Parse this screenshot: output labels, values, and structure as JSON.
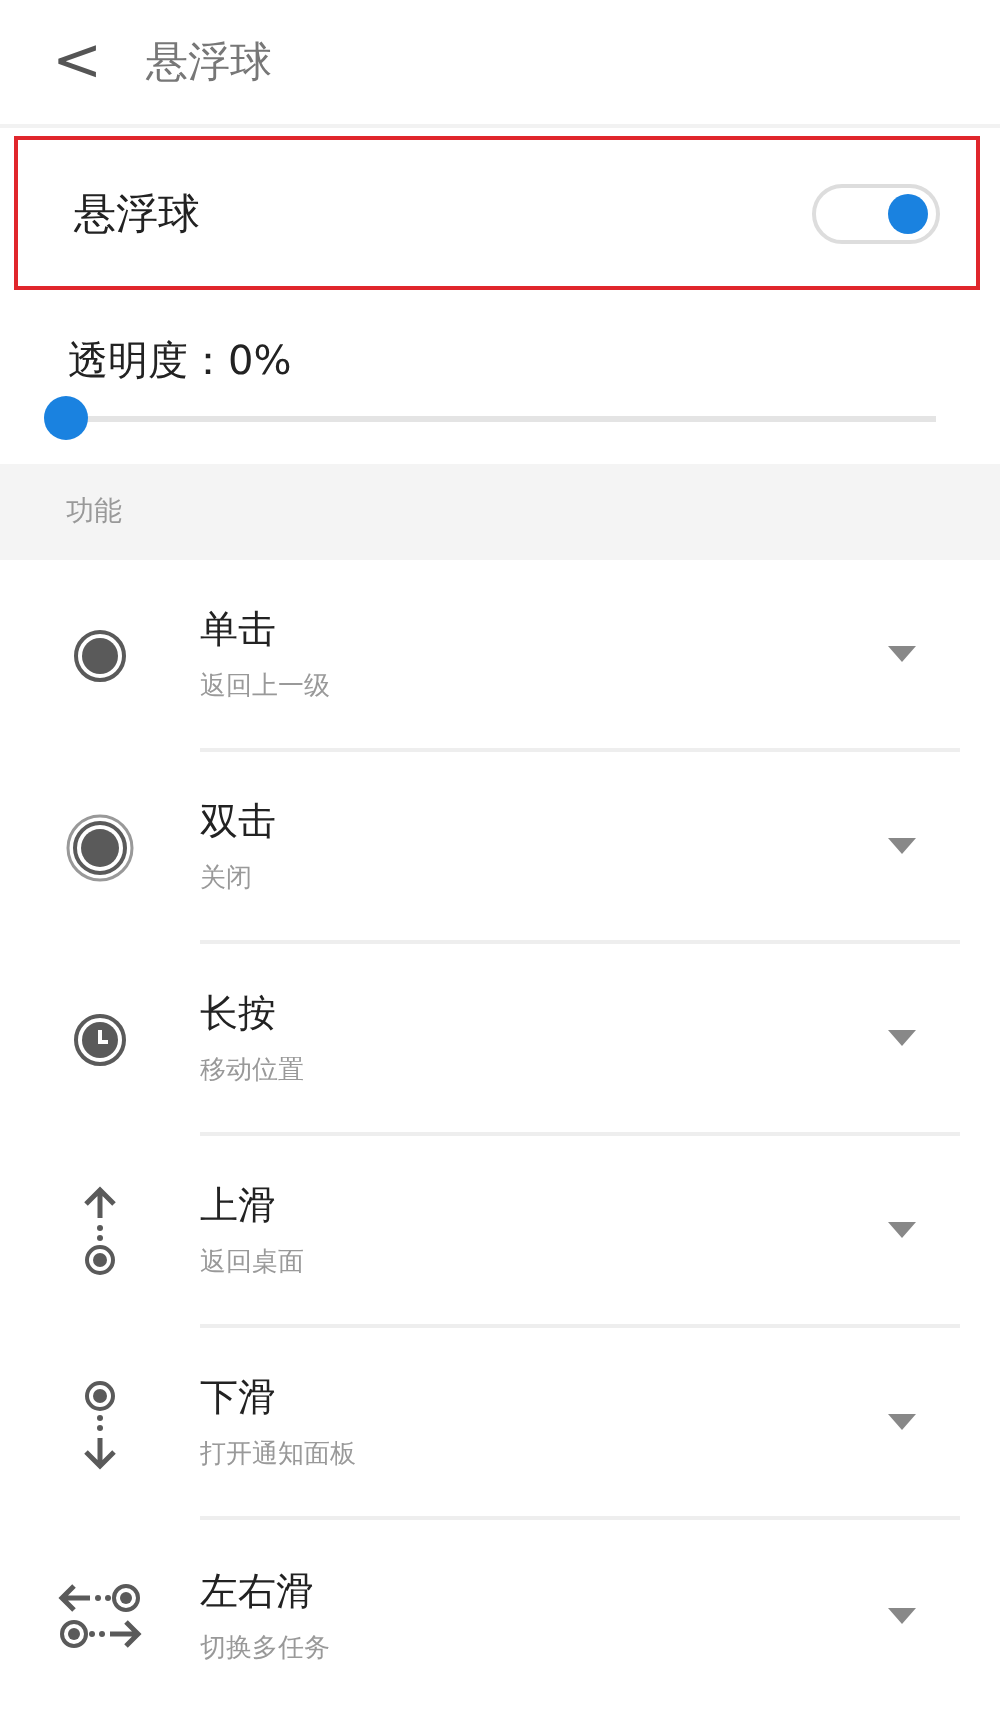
{
  "header": {
    "back": "<",
    "title": "悬浮球"
  },
  "toggle": {
    "label": "悬浮球",
    "on": true
  },
  "opacity": {
    "label": "透明度：0%",
    "level": 0
  },
  "section": {
    "title": "功能"
  },
  "actions": [
    {
      "kind": "tap",
      "title": "单击",
      "value": "返回上一级"
    },
    {
      "kind": "double-tap",
      "title": "双击",
      "value": "关闭"
    },
    {
      "kind": "long-press",
      "title": "长按",
      "value": "移动位置"
    },
    {
      "kind": "swipe-up",
      "title": "上滑",
      "value": "返回桌面"
    },
    {
      "kind": "swipe-down",
      "title": "下滑",
      "value": "打开通知面板"
    },
    {
      "kind": "swipe-sideways",
      "title": "左右滑",
      "value": "切换多任务"
    }
  ]
}
